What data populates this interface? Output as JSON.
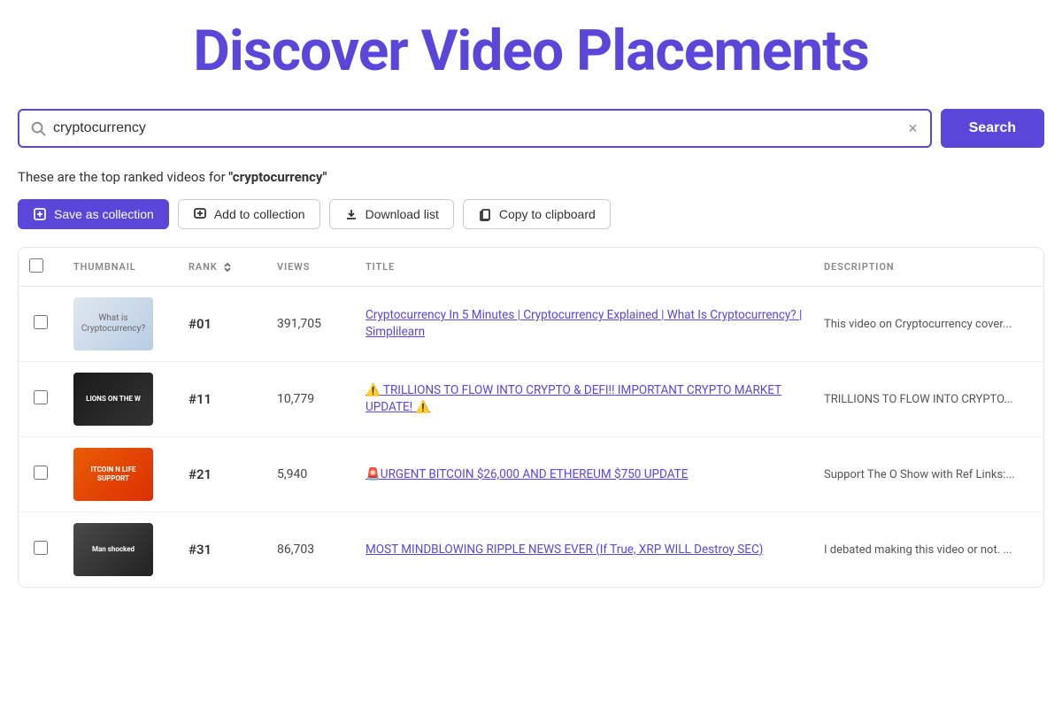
{
  "page": {
    "title": "Discover Video Placements"
  },
  "search": {
    "placeholder": "cryptocurrency",
    "value": "cryptocurrency",
    "button_label": "Search",
    "clear_icon": "×"
  },
  "results_summary": {
    "prefix": "These are the top ranked videos for ",
    "keyword": "\"cryptocurrency\""
  },
  "action_bar": {
    "save_label": "Save as collection",
    "add_label": "Add to collection",
    "download_label": "Download list",
    "copy_label": "Copy to clipboard"
  },
  "table": {
    "headers": {
      "thumbnail": "Thumbnail",
      "rank": "Rank",
      "views": "Views",
      "title": "Title",
      "description": "Description"
    },
    "rows": [
      {
        "id": "row-1",
        "rank": "#01",
        "views": "391,705",
        "title": "Cryptocurrency In 5 Minutes | Cryptocurrency Explained | What Is Cryptocurrency? | Simplilearn",
        "description": "This video on Cryptocurrency cover...",
        "thumb_label": "What is Cryptocurrency?",
        "thumb_class": "thumb-1"
      },
      {
        "id": "row-2",
        "rank": "#11",
        "views": "10,779",
        "title": "⚠️ TRILLIONS TO FLOW INTO CRYPTO & DEFI!! IMPORTANT CRYPTO MARKET UPDATE! ⚠️",
        "description": "TRILLIONS TO FLOW INTO CRYPTO...",
        "thumb_label": "LIONS ON THE W",
        "thumb_class": "thumb-2"
      },
      {
        "id": "row-3",
        "rank": "#21",
        "views": "5,940",
        "title": "🚨URGENT BITCOIN $26,000 AND ETHEREUM $750 UPDATE",
        "description": "Support The O Show with Ref Links:...",
        "thumb_label": "ITCOIN N LIFE SUPPORT",
        "thumb_class": "thumb-3"
      },
      {
        "id": "row-4",
        "rank": "#31",
        "views": "86,703",
        "title": "MOST MINDBLOWING RIPPLE NEWS EVER (If True, XRP WILL Destroy SEC)",
        "description": "I debated making this video or not. ...",
        "thumb_label": "Man shocked",
        "thumb_class": "thumb-4"
      }
    ]
  }
}
